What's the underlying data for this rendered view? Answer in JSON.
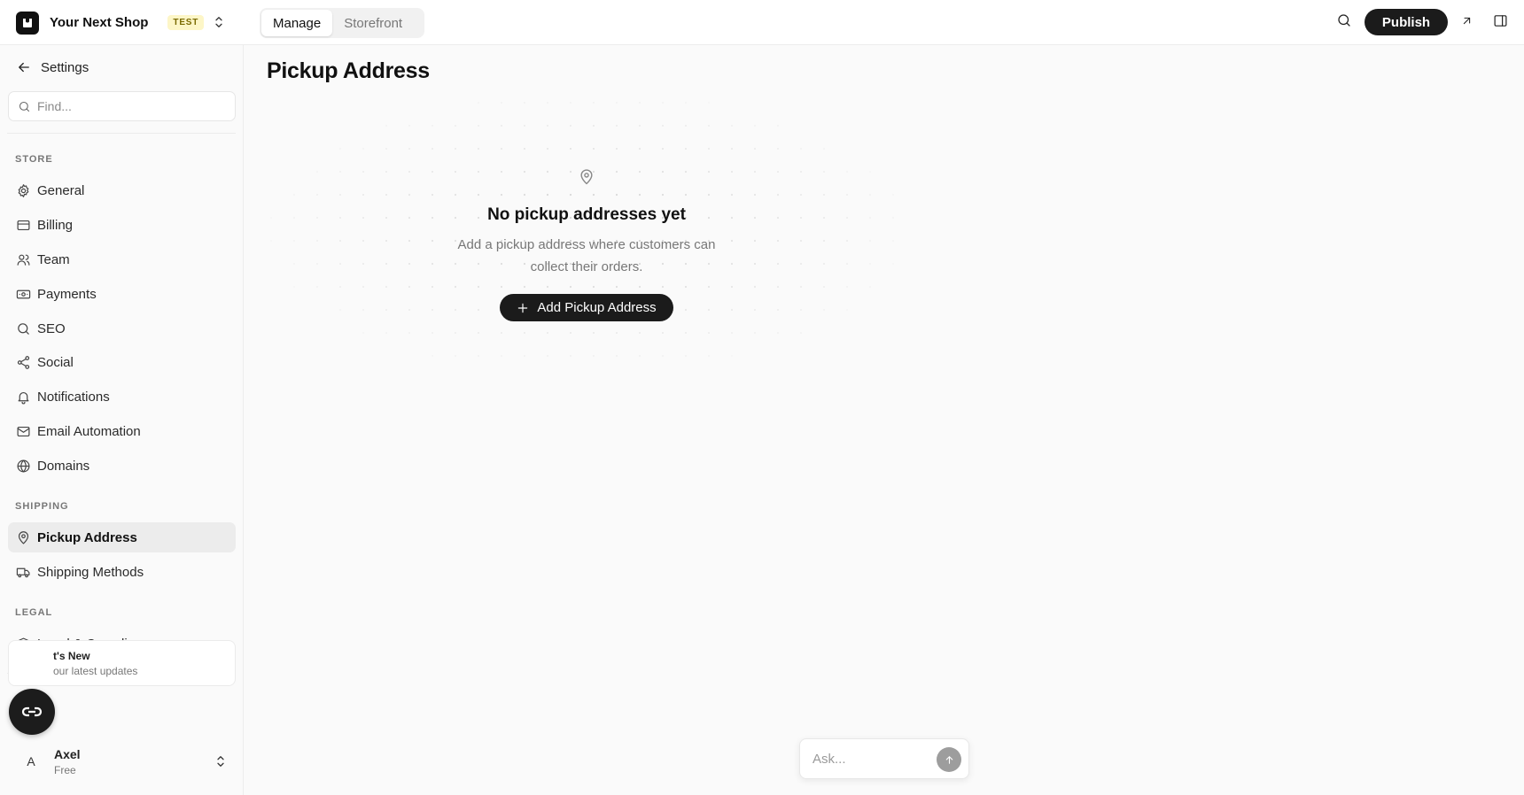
{
  "topbar": {
    "shop_name": "Your Next Shop",
    "env_badge": "TEST",
    "tabs": [
      {
        "label": "Manage",
        "active": true
      },
      {
        "label": "Storefront",
        "active": false
      }
    ],
    "publish_label": "Publish"
  },
  "sidebar": {
    "back_label": "Settings",
    "find_placeholder": "Find...",
    "sections": {
      "store": "STORE",
      "shipping": "SHIPPING",
      "legal": "LEGAL"
    },
    "items": [
      {
        "label": "General",
        "icon": "gear-icon"
      },
      {
        "label": "Billing",
        "icon": "credit-card-icon"
      },
      {
        "label": "Team",
        "icon": "users-icon"
      },
      {
        "label": "Payments",
        "icon": "banknote-icon"
      },
      {
        "label": "SEO",
        "icon": "search-icon"
      },
      {
        "label": "Social",
        "icon": "share-icon"
      },
      {
        "label": "Notifications",
        "icon": "bell-icon"
      },
      {
        "label": "Email Automation",
        "icon": "mail-icon"
      },
      {
        "label": "Domains",
        "icon": "globe-icon"
      },
      {
        "label": "Pickup Address",
        "icon": "map-pin-icon",
        "active": true
      },
      {
        "label": "Shipping Methods",
        "icon": "truck-icon"
      },
      {
        "label": "Legal & Compliance",
        "icon": "shield-check-icon"
      }
    ],
    "whats_new": {
      "title": "t's New",
      "subtitle": "our latest updates"
    },
    "user": {
      "initial": "A",
      "name": "Axel",
      "plan": "Free"
    }
  },
  "main": {
    "page_title": "Pickup Address",
    "empty_state": {
      "title": "No pickup addresses yet",
      "description": "Add a pickup address where customers can collect their orders.",
      "button_label": "Add Pickup Address"
    },
    "ask": {
      "placeholder": "Ask..."
    }
  },
  "colors": {
    "accent_dark": "#1b1b1b",
    "badge_bg": "#fdf6c7",
    "active_item_bg": "#ececec"
  }
}
